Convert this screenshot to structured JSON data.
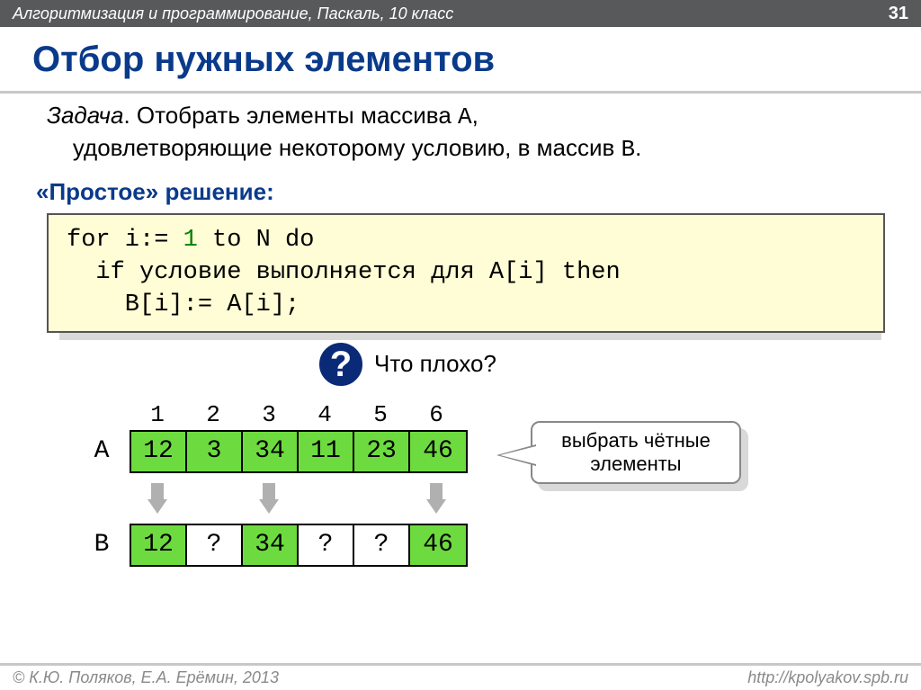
{
  "header": {
    "breadcrumb": "Алгоритмизация и программирование, Паскаль, 10 класс",
    "page": "31"
  },
  "title": "Отбор нужных элементов",
  "task": {
    "label": "Задача",
    "line1_a": ". Отобрать элементы массива ",
    "array_a": "A",
    "line1_b": ",",
    "line2_a": "удовлетворяющие некоторому условию, в массив ",
    "array_b": "B",
    "line2_b": "."
  },
  "subtitle": "«Простое» решение:",
  "code": {
    "line1_a": "for i:= ",
    "line1_hl": "1",
    "line1_b": " to N do",
    "line2": "  if условие выполняется для A[i] then",
    "line3": "    B[i]:= A[i];"
  },
  "question": {
    "mark": "?",
    "text": "Что плохо?"
  },
  "arrays": {
    "indices": [
      "1",
      "2",
      "3",
      "4",
      "5",
      "6"
    ],
    "labelA": "A",
    "A": [
      "12",
      "3",
      "34",
      "11",
      "23",
      "46"
    ],
    "labelB": "B",
    "B": [
      "12",
      "?",
      "34",
      "?",
      "?",
      "46"
    ],
    "B_filled": [
      true,
      false,
      true,
      false,
      false,
      true
    ]
  },
  "callout": "выбрать чётные элементы",
  "footer": {
    "left": "© К.Ю. Поляков, Е.А. Ерёмин, 2013",
    "right": "http://kpolyakov.spb.ru"
  }
}
